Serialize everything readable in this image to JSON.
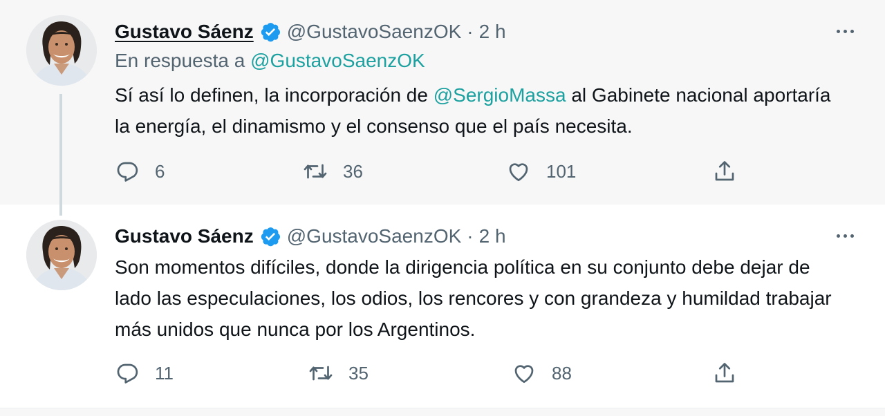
{
  "tweets": [
    {
      "author": {
        "name": "Gustavo Sáenz",
        "handle": "@GustavoSaenzOK"
      },
      "separator": "·",
      "time": "2 h",
      "reply_to": {
        "prefix": "En respuesta a ",
        "mention": "@GustavoSaenzOK"
      },
      "text": {
        "before": "Sí así lo definen, la incorporación de ",
        "mention": "@SergioMassa",
        "after": " al Gabinete nacional aportaría la energía, el dinamismo y el consenso que el país necesita."
      },
      "stats": {
        "replies": "6",
        "retweets": "36",
        "likes": "101"
      }
    },
    {
      "author": {
        "name": "Gustavo Sáenz",
        "handle": "@GustavoSaenzOK"
      },
      "separator": "·",
      "time": "2 h",
      "text": {
        "body": "Son momentos difíciles, donde la dirigencia política en su conjunto debe dejar de lado las especulaciones, los odios, los rencores y con grandeza y humildad trabajar más unidos que nunca por los Argentinos."
      },
      "stats": {
        "replies": "11",
        "retweets": "35",
        "likes": "88"
      }
    }
  ],
  "icons": {
    "verified": "verified-badge-icon",
    "more": "more-horizontal-icon",
    "reply": "reply-icon",
    "retweet": "retweet-icon",
    "like": "like-icon",
    "share": "share-icon"
  },
  "colors": {
    "mention": "#1da1a0",
    "verified": "#1d9bf0",
    "secondary_text": "#536471",
    "highlight_bg": "#f7f7f7"
  }
}
